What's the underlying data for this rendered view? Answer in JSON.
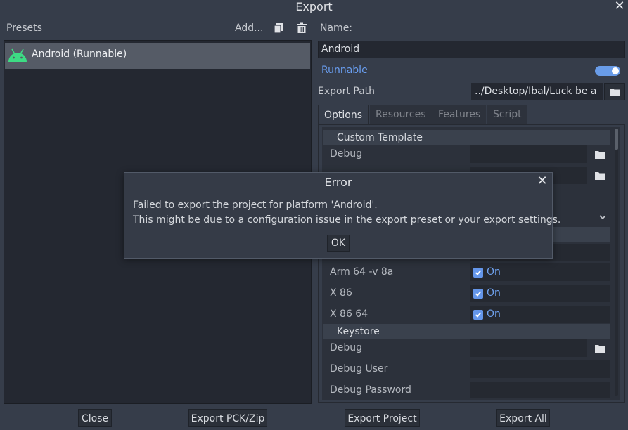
{
  "window": {
    "title": "Export"
  },
  "presets": {
    "label": "Presets",
    "add_label": "Add...",
    "items": [
      {
        "label": "Android (Runnable)",
        "icon": "android-icon"
      }
    ]
  },
  "details": {
    "name_label": "Name:",
    "name_value": "Android",
    "runnable_label": "Runnable",
    "runnable_on": true,
    "export_path_label": "Export Path",
    "export_path_value": "../Desktop/Ibal/Luck be a"
  },
  "tabs": [
    {
      "label": "Options",
      "active": true
    },
    {
      "label": "Resources",
      "active": false
    },
    {
      "label": "Features",
      "active": false
    },
    {
      "label": "Script",
      "active": false
    }
  ],
  "options": {
    "custom_template_header": "Custom Template",
    "custom_template_debug": "Debug",
    "arm64_label": "Arm 64 -v 8a",
    "x86_label": "X 86",
    "x86_64_label": "X 86 64",
    "on_label": "On",
    "keystore_header": "Keystore",
    "keystore_debug": "Debug",
    "keystore_debug_user": "Debug User",
    "keystore_debug_password": "Debug Password"
  },
  "buttons": {
    "close": "Close",
    "export_pck": "Export PCK/Zip",
    "export_project": "Export Project",
    "export_all": "Export All"
  },
  "error_dialog": {
    "title": "Error",
    "line1": "Failed to export the project for platform 'Android'.",
    "line2": "This might be due to a configuration issue in the export preset or your export settings.",
    "ok": "OK"
  },
  "colors": {
    "accent": "#6a9ff2",
    "android_green": "#3ddc84",
    "background": "#363d4a"
  }
}
